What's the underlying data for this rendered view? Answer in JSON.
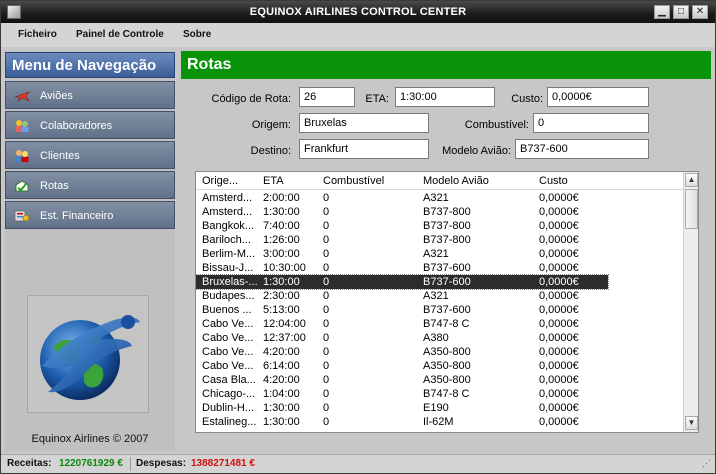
{
  "window": {
    "title": "EQUINOX AIRLINES CONTROL CENTER"
  },
  "menu": [
    "Ficheiro",
    "Painel de Controle",
    "Sobre"
  ],
  "sidebar": {
    "header": "Menu de Navegação",
    "items": [
      {
        "label": "Aviões",
        "icon": "airplane-icon"
      },
      {
        "label": "Colaboradores",
        "icon": "people-icon"
      },
      {
        "label": "Clientes",
        "icon": "clients-icon"
      },
      {
        "label": "Rotas",
        "icon": "routes-icon"
      },
      {
        "label": "Est. Financeiro",
        "icon": "finance-icon"
      }
    ],
    "footer": "Equinox Airlines © 2007"
  },
  "page": {
    "title": "Rotas",
    "form": {
      "codigo_label": "Código de Rota:",
      "codigo_value": "26",
      "eta_label": "ETA:",
      "eta_value": "1:30:00",
      "custo_label": "Custo:",
      "custo_value": "0,0000€",
      "origem_label": "Origem:",
      "origem_value": "Bruxelas",
      "combustivel_label": "Combustível:",
      "combustivel_value": "0",
      "destino_label": "Destino:",
      "destino_value": "Frankfurt",
      "modelo_label": "Modelo Avião:",
      "modelo_value": "B737-600"
    },
    "table": {
      "columns": [
        "Orige...",
        "ETA",
        "Combustível",
        "Modelo Avião",
        "Custo"
      ],
      "rows": [
        [
          "Amsterd...",
          "2:00:00",
          "0",
          "A321",
          "0,0000€"
        ],
        [
          "Amsterd...",
          "1:30:00",
          "0",
          "B737-800",
          "0,0000€"
        ],
        [
          "Bangkok...",
          "7:40:00",
          "0",
          "B737-800",
          "0,0000€"
        ],
        [
          "Bariloch...",
          "1:26:00",
          "0",
          "B737-800",
          "0,0000€"
        ],
        [
          "Berlim-M...",
          "3:00:00",
          "0",
          "A321",
          "0,0000€"
        ],
        [
          "Bissau-J...",
          "10:30:00",
          "0",
          "B737-600",
          "0,0000€"
        ],
        [
          "Bruxelas-...",
          "1:30:00",
          "0",
          "B737-600",
          "0,0000€"
        ],
        [
          "Budapes...",
          "2:30:00",
          "0",
          "A321",
          "0,0000€"
        ],
        [
          "Buenos ...",
          "5:13:00",
          "0",
          "B737-600",
          "0,0000€"
        ],
        [
          "Cabo Ve...",
          "12:04:00",
          "0",
          "B747-8 C",
          "0,0000€"
        ],
        [
          "Cabo Ve...",
          "12:37:00",
          "0",
          "A380",
          "0,0000€"
        ],
        [
          "Cabo Ve...",
          "4:20:00",
          "0",
          "A350-800",
          "0,0000€"
        ],
        [
          "Cabo Ve...",
          "6:14:00",
          "0",
          "A350-800",
          "0,0000€"
        ],
        [
          "Casa Bla...",
          "4:20:00",
          "0",
          "A350-800",
          "0,0000€"
        ],
        [
          "Chicago-...",
          "1:04:00",
          "0",
          "B747-8 C",
          "0,0000€"
        ],
        [
          "Dublin-H...",
          "1:30:00",
          "0",
          "E190",
          "0,0000€"
        ],
        [
          "Estalineg...",
          "1:30:00",
          "0",
          "Il-62M",
          "0,0000€"
        ]
      ],
      "selected_index": 6
    }
  },
  "status": {
    "receitas_label": "Receitas:",
    "receitas_value": "1220761929 €",
    "despesas_label": "Despesas:",
    "despesas_value": "1388271481 €"
  },
  "colors": {
    "header_green": "#089308",
    "nav_blue": "#3b5d97",
    "receitas_color": "#0a8a0a",
    "despesas_color": "#d01010"
  }
}
